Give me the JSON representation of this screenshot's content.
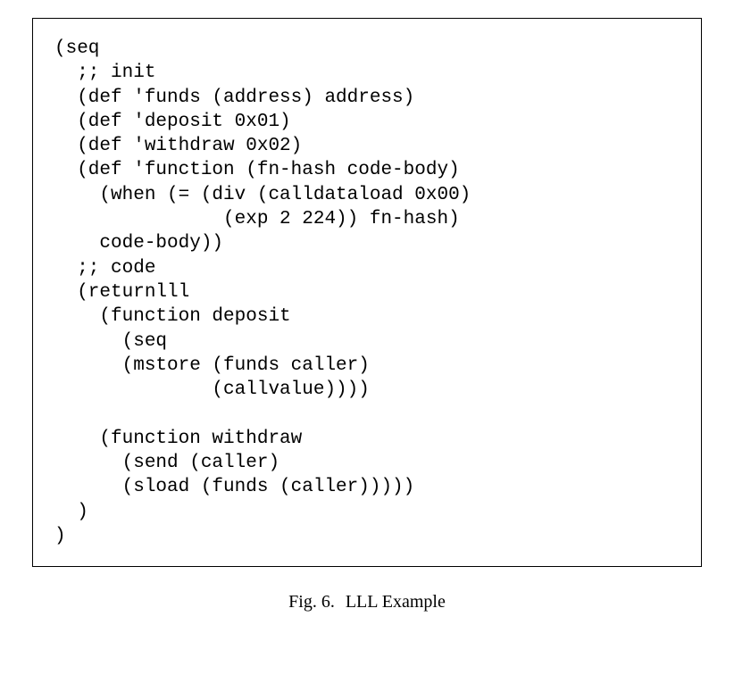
{
  "code": {
    "l1": "(seq",
    "l2": "  ;; init",
    "l3": "  (def 'funds (address) address)",
    "l4": "  (def 'deposit 0x01)",
    "l5": "  (def 'withdraw 0x02)",
    "l6": "  (def 'function (fn-hash code-body)",
    "l7": "    (when (= (div (calldataload 0x00)",
    "l8": "               (exp 2 224)) fn-hash)",
    "l9": "    code-body))",
    "l10": "  ;; code",
    "l11": "  (returnlll",
    "l12": "    (function deposit",
    "l13": "      (seq",
    "l14": "      (mstore (funds caller)",
    "l15": "              (callvalue))))",
    "l16": "",
    "l17": "    (function withdraw",
    "l18": "      (send (caller)",
    "l19": "      (sload (funds (caller)))))",
    "l20": "  )",
    "l21": ")"
  },
  "caption": {
    "label": "Fig. 6.",
    "title": "LLL Example"
  }
}
